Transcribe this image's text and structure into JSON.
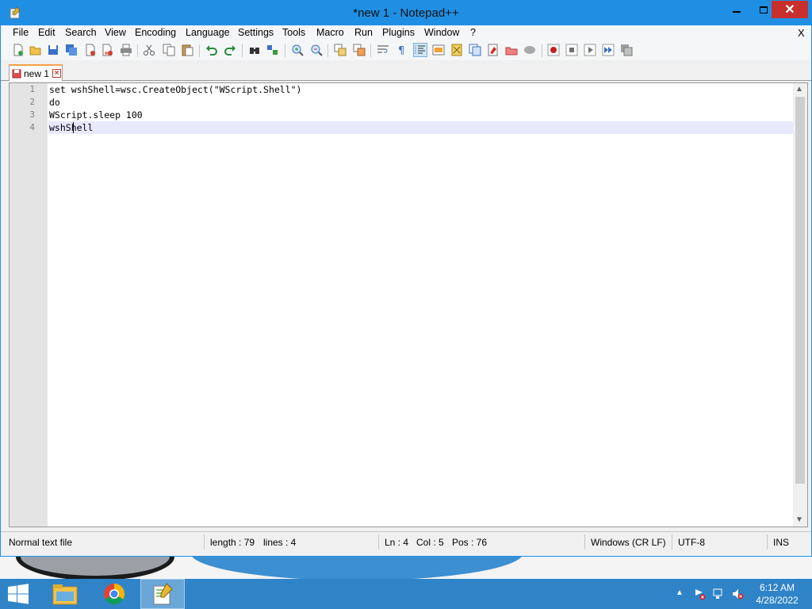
{
  "window": {
    "title": "*new 1 - Notepad++"
  },
  "menu": {
    "items": [
      "File",
      "Edit",
      "Search",
      "View",
      "Encoding",
      "Language",
      "Settings",
      "Tools",
      "Macro",
      "Run",
      "Plugins",
      "Window",
      "?"
    ],
    "close_x": "X"
  },
  "toolbar": {
    "icons": [
      "new-file-icon",
      "open-file-icon",
      "save-icon",
      "save-all-icon",
      "close-icon",
      "close-all-icon",
      "print-icon",
      "cut-icon",
      "copy-icon",
      "paste-icon",
      "undo-icon",
      "redo-icon",
      "find-icon",
      "replace-icon",
      "zoom-in-icon",
      "zoom-out-icon",
      "sync-vertical-icon",
      "sync-horizontal-icon",
      "word-wrap-icon",
      "show-all-characters-icon",
      "indent-guide-icon",
      "user-language-icon",
      "document-map-icon",
      "function-list-icon",
      "folder-as-workspace-icon",
      "monitoring-icon",
      "record-macro-icon",
      "stop-recording-icon",
      "playback-icon",
      "run-macro-multiple-icon",
      "save-macro-icon"
    ]
  },
  "tabs": [
    {
      "label": "new 1",
      "close": "×"
    }
  ],
  "editor": {
    "lines": [
      {
        "num": "1",
        "text": "set wshShell=wsc.CreateObject(\"WScript.Shell\")"
      },
      {
        "num": "2",
        "text": "do"
      },
      {
        "num": "3",
        "text": "WScript.sleep 100"
      },
      {
        "num": "4",
        "text": "wshShell"
      }
    ],
    "current_line": 4
  },
  "status": {
    "file_type": "Normal text file",
    "length": "length : 79",
    "lines": "lines : 4",
    "ln": "Ln : 4",
    "col": "Col : 5",
    "pos": "Pos : 76",
    "eol": "Windows (CR LF)",
    "encoding": "UTF-8",
    "mode": "INS"
  },
  "taskbar": {
    "apps": [
      "file-explorer-icon",
      "chrome-icon",
      "notepad-plus-plus-icon"
    ],
    "clock_time": "6:12 AM",
    "clock_date": "4/28/2022"
  },
  "colors": {
    "titlebar": "#1f8fe4",
    "taskbar": "#2f84c8",
    "close_button": "#c7302c",
    "current_line": "#e8e8ff"
  }
}
